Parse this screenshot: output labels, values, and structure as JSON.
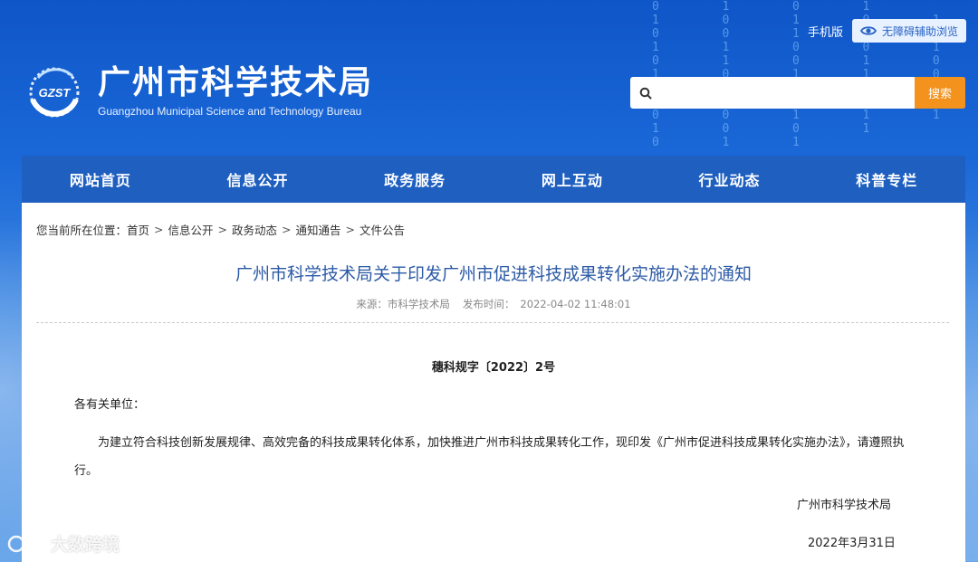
{
  "header": {
    "logo": {
      "emblem_text": "GZST",
      "name_cn": "广州市科学技术局",
      "name_en": "Guangzhou Municipal Science and Technology Bureau"
    },
    "mobile_label": "手机版",
    "accessibility_label": "无障碍辅助浏览",
    "search": {
      "placeholder": "",
      "button_label": "搜索"
    }
  },
  "nav": {
    "items": [
      "网站首页",
      "信息公开",
      "政务服务",
      "网上互动",
      "行业动态",
      "科普专栏"
    ]
  },
  "breadcrumb": {
    "prefix": "您当前所在位置：",
    "items": [
      "首页",
      "信息公开",
      "政务动态",
      "通知通告",
      "文件公告"
    ]
  },
  "article": {
    "title": "广州市科学技术局关于印发广州市促进科技成果转化实施办法的通知",
    "source_label": "来源：市科学技术局",
    "publish_label": "发布时间：",
    "publish_time": "2022-04-02 11:48:01",
    "doc_number": "穗科规字〔2022〕2号",
    "salutation": "各有关单位：",
    "body": "为建立符合科技创新发展规律、高效完备的科技成果转化体系，加快推进广州市科技成果转化工作，现印发《广州市促进科技成果转化实施办法》，请遵照执行。",
    "signature_org": "广州市科学技术局",
    "signature_date": "2022年3月31日"
  },
  "watermark": {
    "text": "大数跨境"
  },
  "colors": {
    "nav_bg": "#1e5fc0",
    "title": "#2c5aa6",
    "search_button": "#f3921c"
  }
}
